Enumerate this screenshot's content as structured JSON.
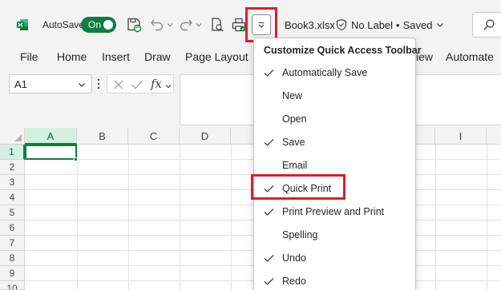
{
  "titlebar": {
    "app_icon": "excel-logo-icon",
    "autosave_label": "AutoSave",
    "autosave_state": "On",
    "doc_name": "Book3.xlsx",
    "sensitivity_label": "No Label",
    "save_status": "Saved",
    "separator": "•"
  },
  "ribbon": {
    "tabs": [
      "File",
      "Home",
      "Insert",
      "Draw",
      "Page Layout",
      "iew",
      "Automate"
    ]
  },
  "formula_bar": {
    "name_box": "A1",
    "fx_label": "fx"
  },
  "grid": {
    "columns": [
      "A",
      "B",
      "C",
      "D",
      "I"
    ],
    "rows": [
      "1",
      "2",
      "3",
      "4",
      "5",
      "6",
      "7",
      "8",
      "9",
      "10"
    ]
  },
  "menu": {
    "title": "Customize Quick Access Toolbar",
    "items": [
      {
        "label": "Automatically Save",
        "checked": true
      },
      {
        "label": "New",
        "checked": false
      },
      {
        "label": "Open",
        "checked": false
      },
      {
        "label": "Save",
        "checked": true
      },
      {
        "label": "Email",
        "checked": false
      },
      {
        "label": "Quick Print",
        "checked": true
      },
      {
        "label": "Print Preview and Print",
        "checked": true
      },
      {
        "label": "Spelling",
        "checked": false
      },
      {
        "label": "Undo",
        "checked": true
      },
      {
        "label": "Redo",
        "checked": true
      }
    ]
  },
  "colors": {
    "excel_green": "#107c41",
    "highlight_red": "#e11d2a",
    "chrome_bg": "#f3f3f3"
  }
}
